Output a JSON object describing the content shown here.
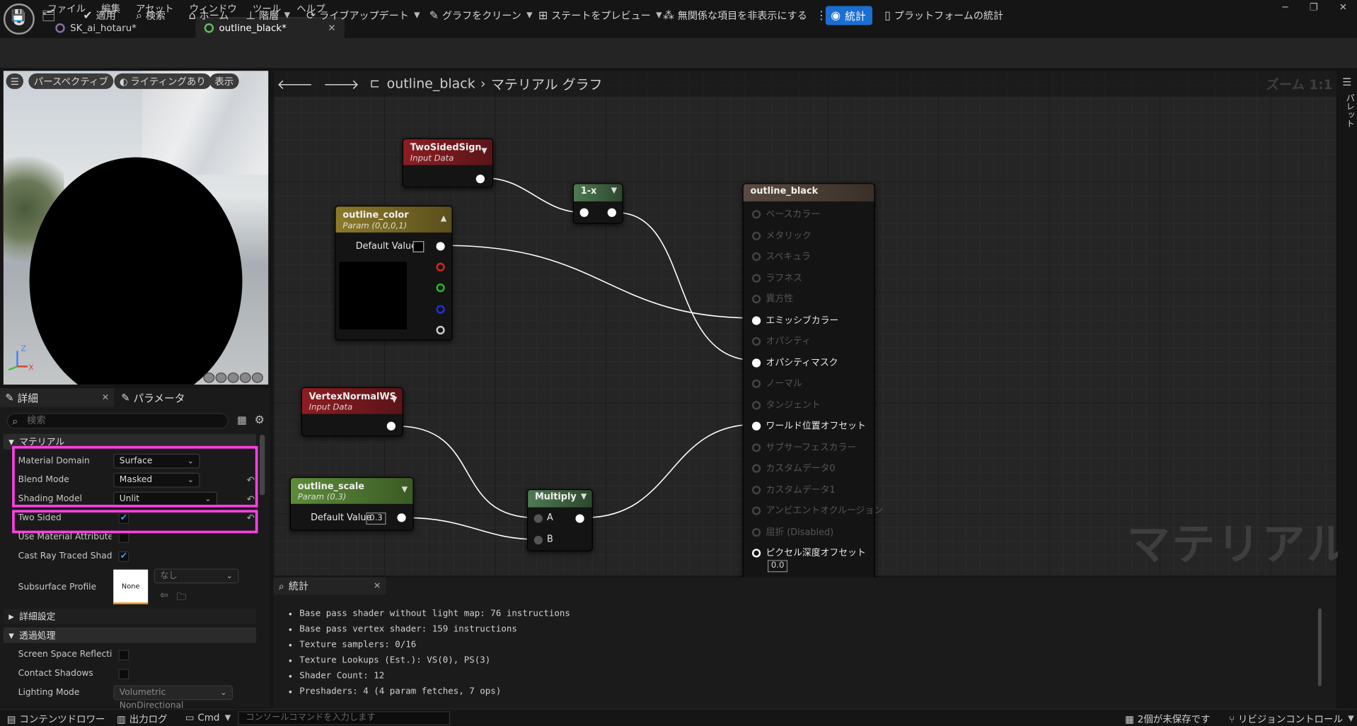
{
  "app": {
    "menu": [
      "ファイル",
      "編集",
      "アセット",
      "ウィンドウ",
      "ツール",
      "ヘルプ"
    ],
    "tabs": [
      {
        "label": "SK_ai_hotaru*"
      },
      {
        "label": "outline_black*"
      }
    ]
  },
  "toolbar": {
    "save": "save-icon",
    "browse": "browse-icon",
    "apply": "適用",
    "search": "検索",
    "home": "ホーム",
    "hierarchy": "階層",
    "live_update": "ライブアップデート",
    "clean_graph": "グラフをクリーン",
    "preview_state": "ステートをプレビュー",
    "hide_unrelated": "無関係な項目を非表示にする",
    "stats": "統計",
    "platform_stats": "プラットフォームの統計"
  },
  "viewport": {
    "perspective": "パースペクティブ",
    "lighting": "ライティングあり",
    "show": "表示",
    "axis": {
      "x": "X",
      "y": "Y",
      "z": "Z"
    }
  },
  "details": {
    "tab_details": "詳細",
    "tab_params": "パラメータ",
    "search_placeholder": "検索",
    "section_material": "マテリアル",
    "rows": {
      "material_domain": {
        "label": "Material Domain",
        "value": "Surface"
      },
      "blend_mode": {
        "label": "Blend Mode",
        "value": "Masked"
      },
      "shading_model": {
        "label": "Shading Model",
        "value": "Unlit"
      },
      "two_sided": {
        "label": "Two Sided",
        "checked": true
      },
      "use_material_attributes": {
        "label": "Use Material Attributes",
        "checked": false
      },
      "cast_ray_traced": {
        "label": "Cast Ray Traced Shad...",
        "checked": true
      },
      "subsurface": {
        "label": "Subsurface Profile",
        "thumb": "None",
        "value": "なし"
      }
    },
    "section_advanced": "詳細設定",
    "section_translucency": "透過処理",
    "rows2": {
      "ssr": {
        "label": "Screen Space Reflecti...",
        "checked": false
      },
      "contact_shadows": {
        "label": "Contact Shadows",
        "checked": false
      },
      "lighting_mode": {
        "label": "Lighting Mode",
        "value": "Volumetric NonDirectional"
      }
    }
  },
  "graph": {
    "breadcrumb": {
      "asset": "outline_black",
      "sep": "›",
      "view": "マテリアル グラフ"
    },
    "zoom": "ズーム 1:1",
    "watermark": "マテリアル",
    "nodes": {
      "two_sided_sign": {
        "title": "TwoSidedSign",
        "subtitle": "Input Data"
      },
      "one_minus": {
        "title": "1-x"
      },
      "outline_color": {
        "title": "outline_color",
        "subtitle": "Param (0,0,0,1)",
        "default_label": "Default Value"
      },
      "vertex_normal": {
        "title": "VertexNormalWS",
        "subtitle": "Input Data"
      },
      "outline_scale": {
        "title": "outline_scale",
        "subtitle": "Param (0.3)",
        "default_label": "Default Value",
        "default_value": "0.3"
      },
      "multiply": {
        "title": "Multiply",
        "pin_a": "A",
        "pin_b": "B"
      },
      "result": {
        "title": "outline_black",
        "pins": [
          "ベースカラー",
          "メタリック",
          "スペキュラ",
          "ラフネス",
          "異方性",
          "エミッシブカラー",
          "オパシティ",
          "オパシティマスク",
          "ノーマル",
          "タンジェント",
          "ワールド位置オフセット",
          "サブサーフェスカラー",
          "カスタムデータ0",
          "カスタムデータ1",
          "アンビエントオクルージョン",
          "屈折 (Disabled)",
          "ピクセル深度オフセット"
        ],
        "active": [
          "エミッシブカラー",
          "オパシティマスク",
          "ワールド位置オフセット"
        ],
        "pixel_depth_value": "0.0"
      }
    },
    "palette": "パレット"
  },
  "stats": {
    "tab": "統計",
    "lines": [
      "Base pass shader without light map: 76 instructions",
      "Base pass vertex shader: 159 instructions",
      "Texture samplers: 0/16",
      "Texture Lookups (Est.): VS(0), PS(3)",
      "Shader Count: 12",
      "Preshaders: 4  (4 param fetches, 7 ops)"
    ]
  },
  "statusbar": {
    "content_drawer": "コンテンツドロワー",
    "output_log": "出力ログ",
    "cmd": "Cmd",
    "console_placeholder": "コンソールコマンドを入力します",
    "unsaved": "2個が未保存です",
    "revision": "リビジョンコントロール"
  }
}
